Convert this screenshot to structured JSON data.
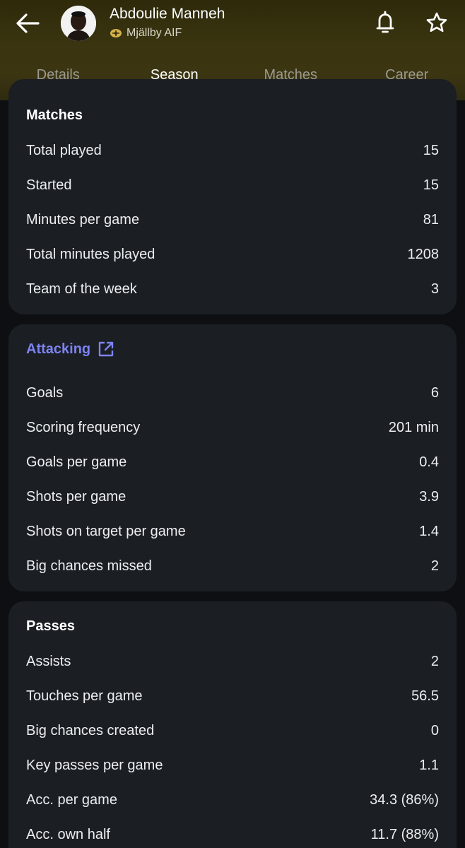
{
  "header": {
    "player_name": "Abdoulie Manneh",
    "team_name": "Mjällby AIF",
    "icons": [
      "back-arrow-icon",
      "avatar",
      "team-crest-icon",
      "bell-icon",
      "star-icon"
    ]
  },
  "tabs": [
    {
      "label": "Details",
      "active": false
    },
    {
      "label": "Season",
      "active": true
    },
    {
      "label": "Matches",
      "active": false
    },
    {
      "label": "Career",
      "active": false
    }
  ],
  "sections": {
    "matches": {
      "title": "Matches",
      "rows": [
        {
          "label": "Total played",
          "value": "15"
        },
        {
          "label": "Started",
          "value": "15"
        },
        {
          "label": "Minutes per game",
          "value": "81"
        },
        {
          "label": "Total minutes played",
          "value": "1208"
        },
        {
          "label": "Team of the week",
          "value": "3"
        }
      ]
    },
    "attacking": {
      "title": "Attacking",
      "rows": [
        {
          "label": "Goals",
          "value": "6"
        },
        {
          "label": "Scoring frequency",
          "value": "201 min"
        },
        {
          "label": "Goals per game",
          "value": "0.4"
        },
        {
          "label": "Shots per game",
          "value": "3.9"
        },
        {
          "label": "Shots on target per game",
          "value": "1.4"
        },
        {
          "label": "Big chances missed",
          "value": "2"
        }
      ]
    },
    "passes": {
      "title": "Passes",
      "rows": [
        {
          "label": "Assists",
          "value": "2"
        },
        {
          "label": "Touches per game",
          "value": "56.5"
        },
        {
          "label": "Big chances created",
          "value": "0"
        },
        {
          "label": "Key passes per game",
          "value": "1.1"
        },
        {
          "label": "Acc. per game",
          "value": "34.3 (86%)"
        },
        {
          "label": "Acc. own half",
          "value": "11.7 (88%)"
        }
      ]
    }
  },
  "colors": {
    "background": "#0d0f12",
    "card": "#1b1f24",
    "header_gold": "#3b3512",
    "link_accent": "#7e83f2",
    "text": "#eceef0"
  }
}
